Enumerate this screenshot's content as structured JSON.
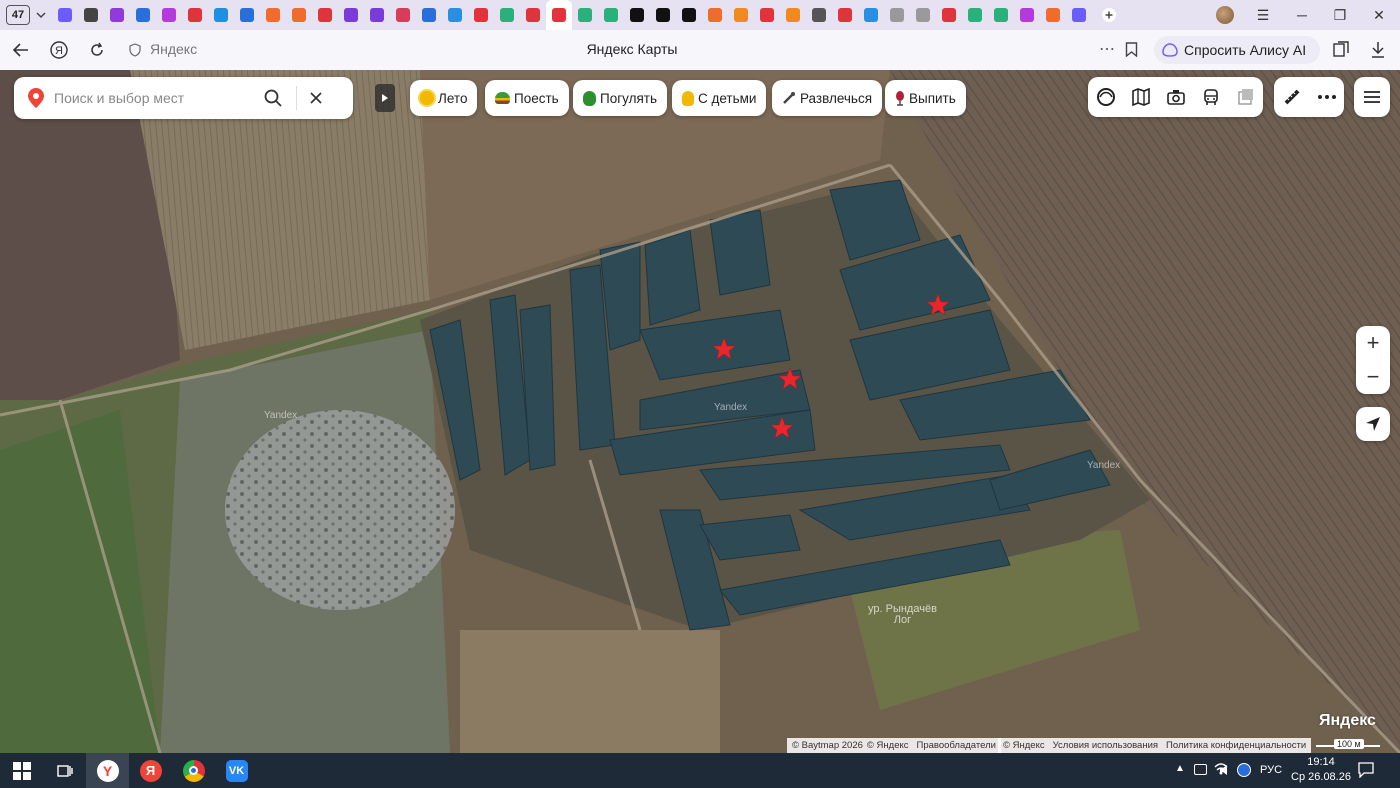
{
  "browser": {
    "tab_count": "47",
    "tabs": [
      {
        "icon": "yandex-lens-tab-icon",
        "color": "#6b5cff"
      },
      {
        "icon": "back-arrow-tab-icon",
        "color": "#444"
      },
      {
        "icon": "purple-tab-icon",
        "color": "#8e3bd9"
      },
      {
        "icon": "news-tab-icon",
        "color": "#2a6fd9"
      },
      {
        "icon": "wb-tab-icon",
        "color": "#b43bd9"
      },
      {
        "icon": "play-tab-icon",
        "color": "#e0333c"
      },
      {
        "icon": "mail-at-tab-icon",
        "color": "#1f8fe0"
      },
      {
        "icon": "u-tab-icon",
        "color": "#2a6fd9"
      },
      {
        "icon": "yandex-tab-icon",
        "color": "#f06b2e"
      },
      {
        "icon": "yandex-tab-icon",
        "color": "#f06b2e"
      },
      {
        "icon": "red-tab-icon",
        "color": "#e0333c"
      },
      {
        "icon": "oval-tab-icon",
        "color": "#7a3bd9"
      },
      {
        "icon": "oval-tab-icon",
        "color": "#7a3bd9"
      },
      {
        "icon": "oval-tab-icon",
        "color": "#d93b5a"
      },
      {
        "icon": "mail-tab-icon",
        "color": "#2a6fd9"
      },
      {
        "icon": "cloud-tab-icon",
        "color": "#2a8fe0"
      },
      {
        "icon": "pdf-tab-icon",
        "color": "#e0333c"
      },
      {
        "icon": "plus-tab-icon",
        "color": "#2ab07a"
      },
      {
        "icon": "map-pin-tab-icon",
        "color": "#e0333c"
      },
      {
        "icon": "map-pin-tab-icon",
        "color": "#e0333c"
      },
      {
        "icon": "puzzle-tab-icon",
        "color": "#2ab07a"
      },
      {
        "icon": "puzzle-tab-icon",
        "color": "#2ab07a"
      },
      {
        "icon": "plus-tab-icon",
        "color": "#111"
      },
      {
        "icon": "plus-tab-icon",
        "color": "#111"
      },
      {
        "icon": "plus-tab-icon",
        "color": "#111"
      },
      {
        "icon": "yandex-tab-icon",
        "color": "#f06b2e"
      },
      {
        "icon": "fruit-tab-icon",
        "color": "#f08a1e"
      },
      {
        "icon": "mushroom-tab-icon",
        "color": "#e0333c"
      },
      {
        "icon": "ok-tab-icon",
        "color": "#f08a1e"
      },
      {
        "icon": "doc-tab-icon",
        "color": "#555"
      },
      {
        "icon": "cross-tab-icon",
        "color": "#e0333c"
      },
      {
        "icon": "puzzle-tab-icon",
        "color": "#2a8fe0"
      },
      {
        "icon": "pen-tab-icon",
        "color": "#999"
      },
      {
        "icon": "pen-tab-icon",
        "color": "#999"
      },
      {
        "icon": "youtube-tab-icon",
        "color": "#e0333c"
      },
      {
        "icon": "check-tab-icon",
        "color": "#2ab07a"
      },
      {
        "icon": "check-tab-icon",
        "color": "#2ab07a"
      },
      {
        "icon": "wb-tab-icon",
        "color": "#b43bd9"
      },
      {
        "icon": "yandex-tab-icon",
        "color": "#f06b2e"
      },
      {
        "icon": "lens-tab-icon",
        "color": "#6b5cff"
      }
    ],
    "address_text": "Яндекс",
    "page_title": "Яндекс Карты",
    "alisa_button": "Спросить Алису AI"
  },
  "map": {
    "search_placeholder": "Поиск и выбор мест",
    "chips": [
      {
        "label": "Лето",
        "icon": "sun-icon",
        "color": "#f2b800"
      },
      {
        "label": "Поесть",
        "icon": "burger-icon",
        "color": "#3a9a3a"
      },
      {
        "label": "Погулять",
        "icon": "tree-icon",
        "color": "#2f8f2f"
      },
      {
        "label": "С детьми",
        "icon": "duck-icon",
        "color": "#f2b800"
      },
      {
        "label": "Развлечься",
        "icon": "wand-icon",
        "color": "#555"
      },
      {
        "label": "Выпить",
        "icon": "glass-icon",
        "color": "#b0203a"
      }
    ],
    "watermarks": [
      "Yandex",
      "Yandex",
      "Yandex"
    ],
    "place_label": "ур. Рындачёв\nЛог",
    "logo": "Яндекс",
    "scale": "100 м",
    "copyright_left": [
      "© Baytmap 2026",
      "© Яндекс",
      "Правообладатели"
    ],
    "copyright_right": [
      "© Яндекс",
      "Условия использования",
      "Политика конфиденциальности"
    ]
  },
  "taskbar": {
    "language": "РУС",
    "time": "19:14",
    "date": "Ср 26.08.26"
  }
}
